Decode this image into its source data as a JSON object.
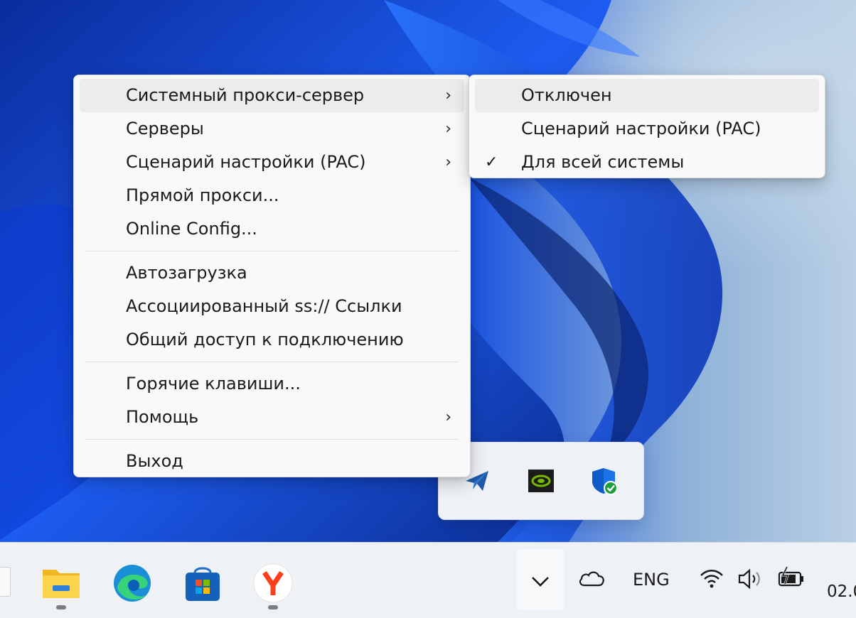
{
  "main_menu": {
    "items": [
      {
        "label": "Системный прокси-сервер",
        "submenu": true,
        "highlighted": true
      },
      {
        "label": "Серверы",
        "submenu": true
      },
      {
        "label": "Сценарий настройки (PAC)",
        "submenu": true
      },
      {
        "label": "Прямой прокси..."
      },
      {
        "label": "Online Config..."
      },
      {
        "label": "Автозагрузка"
      },
      {
        "label": "Ассоциированный ss:// Ссылки"
      },
      {
        "label": "Общий доступ к подключению"
      },
      {
        "label": "Горячие клавиши..."
      },
      {
        "label": "Помощь",
        "submenu": true
      },
      {
        "label": "Выход"
      }
    ]
  },
  "proxy_submenu": {
    "items": [
      {
        "label": "Отключен",
        "highlighted": true
      },
      {
        "label": "Сценарий настройки (PAC)"
      },
      {
        "label": "Для всей системы",
        "checked": true
      }
    ]
  },
  "glyphs": {
    "chevron_right": "›",
    "check": "✓"
  },
  "tray_flyout": {
    "icons": [
      "shadowsocks-paper-plane-icon",
      "nvidia-icon",
      "windows-security-icon"
    ]
  },
  "taskbar": {
    "apps": [
      "file-explorer-icon",
      "edge-icon",
      "microsoft-store-icon",
      "yandex-browser-icon"
    ],
    "language": "ENG",
    "clock_partial": "02.0"
  }
}
